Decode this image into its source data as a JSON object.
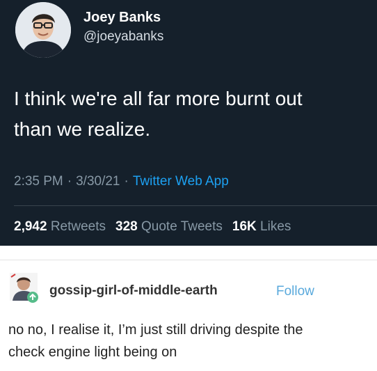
{
  "tweet": {
    "display_name": "Joey Banks",
    "handle": "@joeyabanks",
    "text_line1": "I think we're all far more burnt out",
    "text_line2": "than we realize.",
    "time": "2:35 PM",
    "date": "3/30/21",
    "separator": "·",
    "app": "Twitter Web App",
    "retweets_count": "2,942",
    "retweets_label": "Retweets",
    "quotes_count": "328",
    "quotes_label": "Quote Tweets",
    "likes_count": "16K",
    "likes_label": "Likes"
  },
  "reply": {
    "username": "gossip-girl-of-middle-earth",
    "follow_label": "Follow",
    "text_line1": "no no, I realise it, I’m just still driving despite the",
    "text_line2": "check engine light being on"
  },
  "colors": {
    "tweet_bg": "#15202b",
    "link_blue": "#1da1f2",
    "follow_blue": "#59a9dc",
    "muted": "#8899a6"
  },
  "icons": {
    "avatar": "profile-photo",
    "tumblr_avatar": "profile-photo-with-reblog-badge"
  }
}
